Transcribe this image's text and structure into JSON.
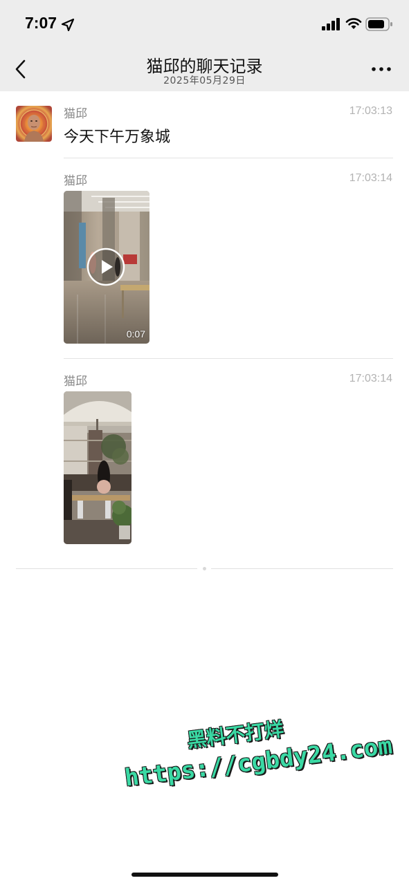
{
  "status_bar": {
    "time": "7:07",
    "icons": [
      "location-arrow-icon",
      "cellular-signal-icon",
      "wifi-icon",
      "battery-icon"
    ]
  },
  "nav": {
    "title": "猫邱的聊天记录",
    "subtitle": "2025年05月29日",
    "back_icon": "chevron-left-icon",
    "more_icon": "more-dots-icon"
  },
  "messages": [
    {
      "sender": "猫邱",
      "time": "17:03:13",
      "type": "text",
      "text": "今天下午万象城"
    },
    {
      "sender": "猫邱",
      "time": "17:03:14",
      "type": "video",
      "duration": "0:07"
    },
    {
      "sender": "猫邱",
      "time": "17:03:14",
      "type": "image"
    }
  ],
  "watermark": {
    "line1": "黑料不打烊",
    "line2": "https://cgbdy24.com",
    "color": "#3ad9a4"
  },
  "colors": {
    "header_bg": "#ededed",
    "time_text": "#b2b2b2",
    "sender_text": "#888888"
  }
}
